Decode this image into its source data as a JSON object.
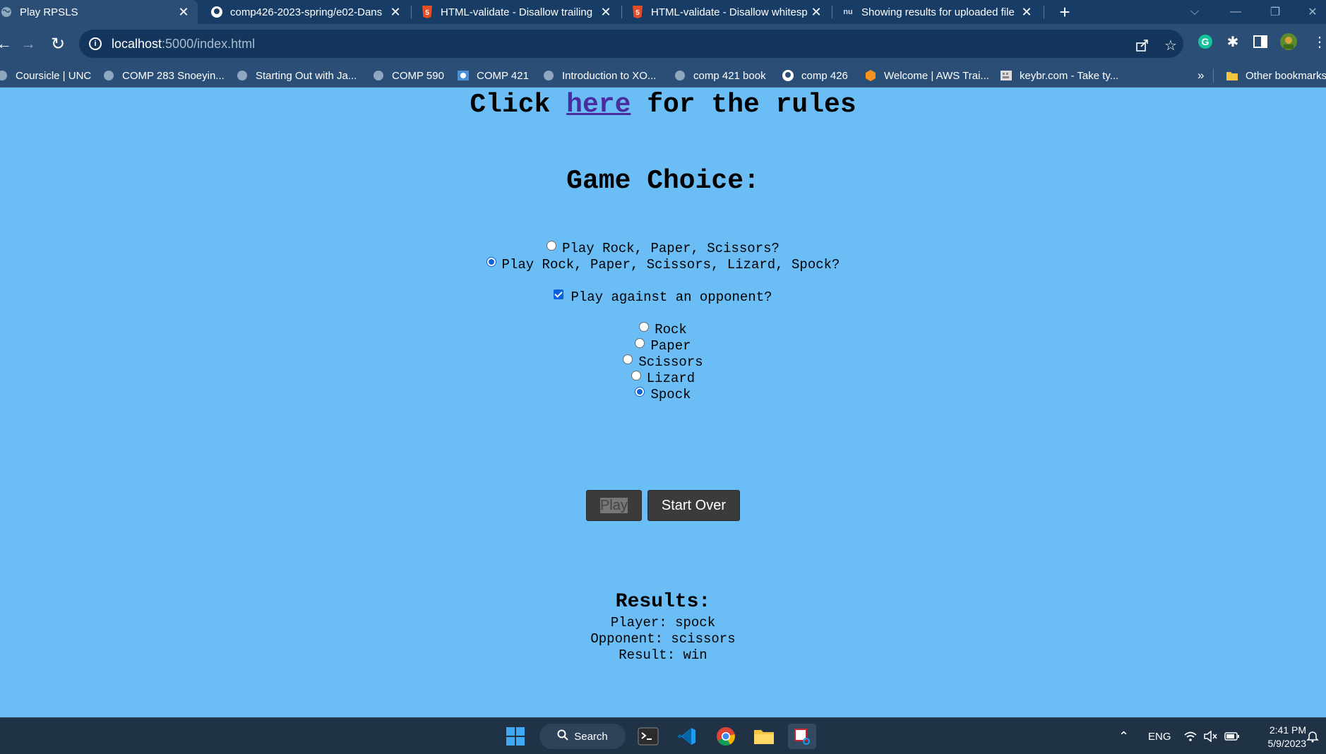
{
  "browser": {
    "tabs": [
      {
        "title": "Play RPSLS",
        "icon": "globe-icon",
        "active": true
      },
      {
        "title": "comp426-2023-spring/e02-Dans",
        "icon": "github-icon",
        "active": false
      },
      {
        "title": "HTML-validate - Disallow trailing",
        "icon": "html5-icon",
        "active": false
      },
      {
        "title": "HTML-validate - Disallow whitesp",
        "icon": "html5-icon",
        "active": false
      },
      {
        "title": "Showing results for uploaded file",
        "icon": "nu-icon",
        "active": false
      }
    ],
    "address": {
      "host": "localhost",
      "rest": ":5000/index.html"
    },
    "bookmarks": [
      {
        "label": "Coursicle | UNC",
        "icon": "globe-icon"
      },
      {
        "label": "COMP 283 Snoeyin...",
        "icon": "globe-icon"
      },
      {
        "label": "Starting Out with Ja...",
        "icon": "globe-icon"
      },
      {
        "label": "COMP 590",
        "icon": "globe-icon"
      },
      {
        "label": "COMP 421",
        "icon": "comp-icon"
      },
      {
        "label": "Introduction to XO...",
        "icon": "globe-icon"
      },
      {
        "label": "comp 421 book",
        "icon": "globe-icon"
      },
      {
        "label": "comp 426",
        "icon": "github-icon"
      },
      {
        "label": "Welcome | AWS Trai...",
        "icon": "aws-icon"
      },
      {
        "label": "keybr.com - Take ty...",
        "icon": "keybr-icon"
      }
    ],
    "bookmarks_more": "»",
    "other_bookmarks": "Other bookmarks"
  },
  "page": {
    "rules": {
      "prefix": "Click ",
      "link": "here",
      "suffix": " for the rules"
    },
    "game_choice_heading": "Game Choice:",
    "game_options": [
      {
        "label": "Play Rock, Paper, Scissors?",
        "checked": false
      },
      {
        "label": "Play Rock, Paper, Scissors, Lizard, Spock?",
        "checked": true
      }
    ],
    "opponent": {
      "label": "Play against an opponent?",
      "checked": true
    },
    "moves": [
      {
        "label": "Rock",
        "checked": false
      },
      {
        "label": "Paper",
        "checked": false
      },
      {
        "label": "Scissors",
        "checked": false
      },
      {
        "label": "Lizard",
        "checked": false
      },
      {
        "label": "Spock",
        "checked": true
      }
    ],
    "buttons": {
      "play": "Play",
      "start_over": "Start Over"
    },
    "results": {
      "heading": "Results:",
      "player": "Player: spock",
      "opponent": "Opponent: scissors",
      "result": "Result: win"
    }
  },
  "taskbar": {
    "search_label": "Search",
    "language": "ENG",
    "time": "2:41 PM",
    "date": "5/9/2023"
  },
  "colors": {
    "page_background": "#6bbdf5",
    "browser_frame": "#173d66",
    "toolbar": "#2b4e77",
    "link": "#4b2c9e",
    "button": "#3b3b3b",
    "accent": "#0b62d9"
  }
}
